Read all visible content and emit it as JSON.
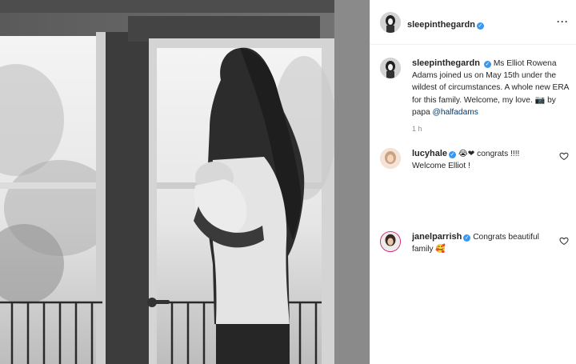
{
  "post": {
    "author": "sleepinthegardn",
    "verified_mark": "✓"
  },
  "caption": {
    "username": "sleepinthegardn",
    "text": "Ms Elliot Rowena Adams joined us on May 15th under the wildest of circumstances. A whole new ERA for this family. Welcome, my love. ",
    "emoji": "📷",
    "text_after": " by papa ",
    "mention": "@halfadams",
    "timestamp": "1 h"
  },
  "comments": [
    {
      "username": "lucyhale",
      "text": "😭❤ congrats !!!! Welcome Elliot !"
    },
    {
      "username": "janelparrish",
      "text": "Congrats beautiful family 🥰"
    }
  ],
  "icons": {
    "more": "more-options-icon",
    "like": "heart-outline-icon",
    "verified": "verified-badge-icon"
  },
  "colors": {
    "verified": "#3897f0",
    "mention": "#00376b",
    "timestamp": "#8e8e8e",
    "divider": "#efefef"
  }
}
